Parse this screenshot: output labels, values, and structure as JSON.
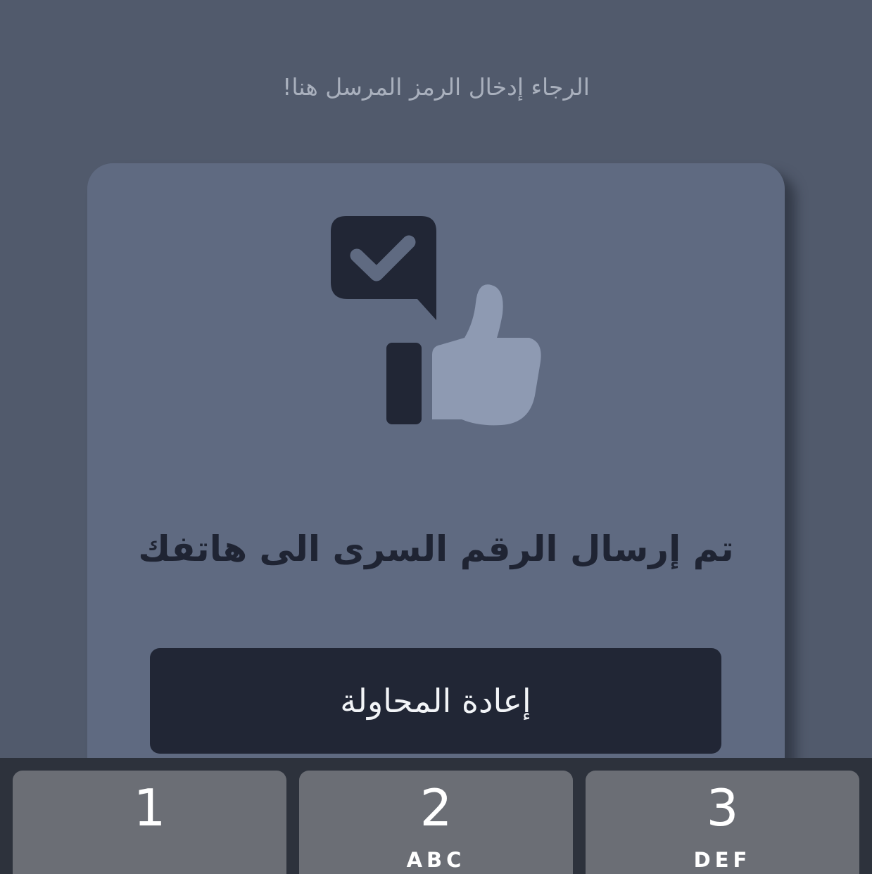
{
  "header": {
    "hint_text": "الرجاء إدخال الرمز المرسل هنا!"
  },
  "card": {
    "icon": "thumbs-up-with-check-bubble-icon",
    "title": "تم إرسال الرقم السرى الى هاتفك",
    "retry_label": "إعادة المحاولة"
  },
  "keypad": {
    "keys": [
      {
        "digit": "1",
        "letters": ""
      },
      {
        "digit": "2",
        "letters": "ABC"
      },
      {
        "digit": "3",
        "letters": "DEF"
      }
    ]
  },
  "colors": {
    "background": "#515a6c",
    "card": "#5f6a81",
    "button": "#212635",
    "keypad_background": "#2d323c",
    "key": "#6b6e75",
    "thumb": "#8e9ab2"
  }
}
